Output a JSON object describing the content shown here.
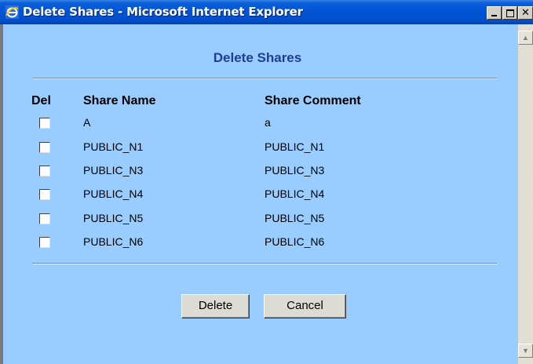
{
  "window": {
    "title": "Delete Shares - Microsoft Internet Explorer",
    "icon": "ie-icon",
    "controls": [
      "minimize-icon",
      "maximize-icon",
      "close-icon"
    ]
  },
  "page": {
    "heading": "Delete Shares",
    "columns": {
      "del": "Del",
      "name": "Share Name",
      "comment": "Share Comment"
    },
    "rows": [
      {
        "checked": false,
        "name": "A",
        "comment": "a"
      },
      {
        "checked": false,
        "name": "PUBLIC_N1",
        "comment": "PUBLIC_N1"
      },
      {
        "checked": false,
        "name": "PUBLIC_N3",
        "comment": "PUBLIC_N3"
      },
      {
        "checked": false,
        "name": "PUBLIC_N4",
        "comment": "PUBLIC_N4"
      },
      {
        "checked": false,
        "name": "PUBLIC_N5",
        "comment": "PUBLIC_N5"
      },
      {
        "checked": false,
        "name": "PUBLIC_N6",
        "comment": "PUBLIC_N6"
      }
    ],
    "buttons": {
      "delete": "Delete",
      "cancel": "Cancel"
    }
  },
  "colors": {
    "page_bg": "#99ccff",
    "heading": "#1c3f95",
    "titlebar": "#0053d6"
  }
}
